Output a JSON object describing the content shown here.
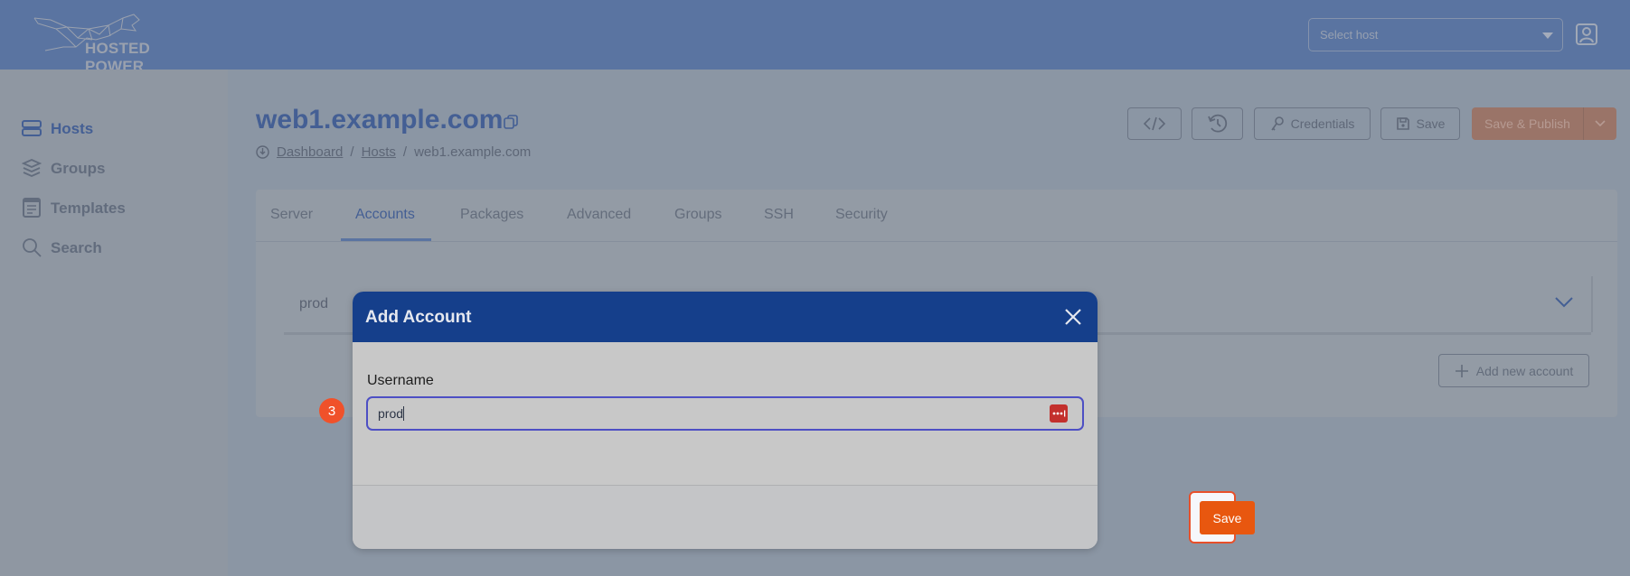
{
  "header": {
    "logo_text": "HOSTED POWER",
    "host_select": {
      "placeholder": "Select host"
    },
    "user_icon": "user-account-icon"
  },
  "sidebar": {
    "items": [
      {
        "label": "Hosts",
        "icon": "server-icon",
        "active": true
      },
      {
        "label": "Groups",
        "icon": "layers-icon",
        "active": false
      },
      {
        "label": "Templates",
        "icon": "document-icon",
        "active": false
      },
      {
        "label": "Search",
        "icon": "search-icon",
        "active": false
      }
    ]
  },
  "page": {
    "title": "web1.example.com",
    "breadcrumb": [
      "Dashboard",
      "Hosts",
      "web1.example.com"
    ],
    "breadcrumb_sep": "/"
  },
  "toolbar": {
    "code_icon": "code-icon",
    "history_icon": "history-icon",
    "credentials_label": "Credentials",
    "save_label": "Save",
    "save_publish_label": "Save & Publish"
  },
  "tabs": [
    {
      "label": "Server",
      "active": false
    },
    {
      "label": "Accounts",
      "active": true
    },
    {
      "label": "Packages",
      "active": false
    },
    {
      "label": "Advanced",
      "active": false
    },
    {
      "label": "Groups",
      "active": false
    },
    {
      "label": "SSH",
      "active": false
    },
    {
      "label": "Security",
      "active": false
    }
  ],
  "accounts": {
    "rows": [
      {
        "name": "prod"
      }
    ],
    "add_label": "Add new account"
  },
  "step_badge": "3",
  "modal": {
    "title": "Add Account",
    "username_label": "Username",
    "username_value": "prod",
    "save_label": "Save"
  },
  "colors": {
    "brand_blue": "#153f8b",
    "accent_orange": "#e8570f",
    "highlight_red": "#e8502a",
    "input_focus": "#4d4fc4"
  }
}
